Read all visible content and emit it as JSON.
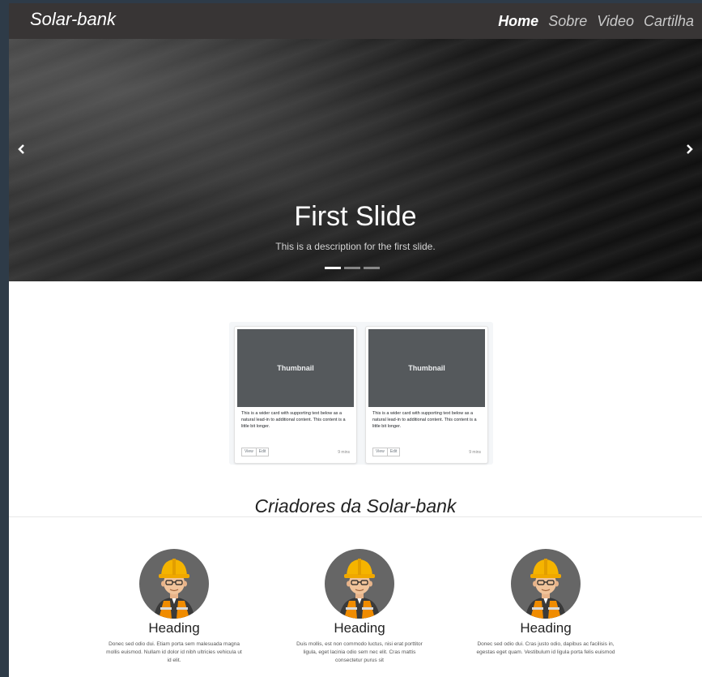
{
  "navbar": {
    "brand": "Solar-bank",
    "links": [
      "Home",
      "Sobre",
      "Video",
      "Cartilha"
    ],
    "active_link": "Home"
  },
  "carousel": {
    "prev_icon": "chevron-left",
    "next_icon": "chevron-right",
    "title": "First Slide",
    "description": "This is a description for the first slide.",
    "indicator_count": 3,
    "active_indicator": 0
  },
  "cards": [
    {
      "thumbnail_label": "Thumbnail",
      "text": "This is a wider card with supporting text below as a natural lead-in to additional content. This content is a little bit longer.",
      "view_label": "View",
      "edit_label": "Edit",
      "time": "9 mins"
    },
    {
      "thumbnail_label": "Thumbnail",
      "text": "This is a wider card with supporting text below as a natural lead-in to additional content. This content is a little bit longer.",
      "view_label": "View",
      "edit_label": "Edit",
      "time": "9 mins"
    }
  ],
  "creators": {
    "title": "Criadores da Solar-bank",
    "people": [
      {
        "heading": "Heading",
        "text": "Donec sed odio dui. Etiam porta sem malesuada magna mollis euismod. Nullam id dolor id nibh ultricies vehicula ut id elit.",
        "avatar_icon": "construction-worker-icon"
      },
      {
        "heading": "Heading",
        "text": "Duis mollis, est non commodo luctus, nisi erat porttitor ligula, eget lacinia odio sem nec elit. Cras mattis consectetur purus sit",
        "avatar_icon": "construction-worker-icon"
      },
      {
        "heading": "Heading",
        "text": "Donec sed odio dui. Cras justo odio, dapibus ac facilisis in, egestas eget quam. Vestibulum id ligula porta felis euismod",
        "avatar_icon": "construction-worker-icon"
      }
    ]
  },
  "colors": {
    "navbar_bg": "#383535",
    "outer_bg": "#2e3b48",
    "thumbnail_bg": "#55595c",
    "avatar_bg": "#666666",
    "helmet": "#f5b400",
    "vest": "#f08c00"
  }
}
